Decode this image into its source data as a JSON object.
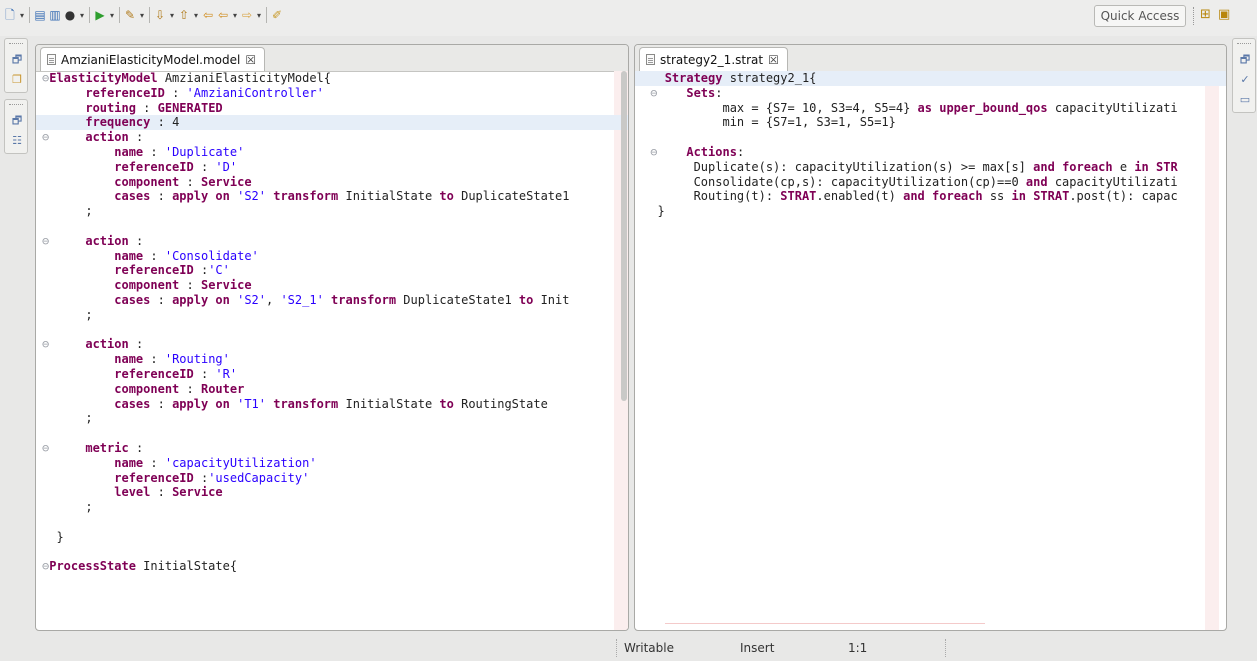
{
  "toolbar": {
    "icons": [
      "new-file-icon",
      "save-icon",
      "print-icon",
      "debug-icon",
      "run-icon",
      "external-tools-icon",
      "next-annotation-icon",
      "prev-annotation-icon",
      "back-icon",
      "forward-icon",
      "pin-icon"
    ],
    "quick_access": "Quick Access"
  },
  "editors": [
    {
      "tab": {
        "label": "AmzianiElasticityModel.model",
        "close": "☒"
      },
      "highlight_line": 3,
      "lines": [
        [
          {
            "t": "⊖",
            "c": "fold"
          },
          {
            "t": "ElasticityModel",
            "c": "kw"
          },
          {
            "t": " AmzianiElasticityModel{",
            "c": "plain"
          }
        ],
        [
          {
            "t": "      ",
            "c": "plain"
          },
          {
            "t": "referenceID",
            "c": "kw"
          },
          {
            "t": " : ",
            "c": "plain"
          },
          {
            "t": "'AmzianiController'",
            "c": "str"
          }
        ],
        [
          {
            "t": "      ",
            "c": "plain"
          },
          {
            "t": "routing",
            "c": "kw"
          },
          {
            "t": " : ",
            "c": "plain"
          },
          {
            "t": "GENERATED",
            "c": "kw"
          }
        ],
        [
          {
            "t": "      ",
            "c": "plain"
          },
          {
            "t": "frequency",
            "c": "kw"
          },
          {
            "t": " : 4",
            "c": "plain"
          }
        ],
        [
          {
            "t": "⊖",
            "c": "fold"
          },
          {
            "t": "     ",
            "c": "plain"
          },
          {
            "t": "action",
            "c": "kw"
          },
          {
            "t": " :",
            "c": "plain"
          }
        ],
        [
          {
            "t": "          ",
            "c": "plain"
          },
          {
            "t": "name",
            "c": "kw"
          },
          {
            "t": " : ",
            "c": "plain"
          },
          {
            "t": "'Duplicate'",
            "c": "str"
          }
        ],
        [
          {
            "t": "          ",
            "c": "plain"
          },
          {
            "t": "referenceID",
            "c": "kw"
          },
          {
            "t": " : ",
            "c": "plain"
          },
          {
            "t": "'D'",
            "c": "str"
          }
        ],
        [
          {
            "t": "          ",
            "c": "plain"
          },
          {
            "t": "component",
            "c": "kw"
          },
          {
            "t": " : ",
            "c": "plain"
          },
          {
            "t": "Service",
            "c": "kw"
          }
        ],
        [
          {
            "t": "          ",
            "c": "plain"
          },
          {
            "t": "cases",
            "c": "kw"
          },
          {
            "t": " : ",
            "c": "plain"
          },
          {
            "t": "apply on",
            "c": "kw"
          },
          {
            "t": " ",
            "c": "plain"
          },
          {
            "t": "'S2'",
            "c": "str"
          },
          {
            "t": " ",
            "c": "plain"
          },
          {
            "t": "transform",
            "c": "kw"
          },
          {
            "t": " InitialState ",
            "c": "plain"
          },
          {
            "t": "to",
            "c": "kw"
          },
          {
            "t": " DuplicateState1",
            "c": "plain"
          }
        ],
        [
          {
            "t": "      ;",
            "c": "plain"
          }
        ],
        [
          {
            "t": "",
            "c": "plain"
          }
        ],
        [
          {
            "t": "⊖",
            "c": "fold"
          },
          {
            "t": "     ",
            "c": "plain"
          },
          {
            "t": "action",
            "c": "kw"
          },
          {
            "t": " :",
            "c": "plain"
          }
        ],
        [
          {
            "t": "          ",
            "c": "plain"
          },
          {
            "t": "name",
            "c": "kw"
          },
          {
            "t": " : ",
            "c": "plain"
          },
          {
            "t": "'Consolidate'",
            "c": "str"
          }
        ],
        [
          {
            "t": "          ",
            "c": "plain"
          },
          {
            "t": "referenceID",
            "c": "kw"
          },
          {
            "t": " :",
            "c": "plain"
          },
          {
            "t": "'C'",
            "c": "str"
          }
        ],
        [
          {
            "t": "          ",
            "c": "plain"
          },
          {
            "t": "component",
            "c": "kw"
          },
          {
            "t": " : ",
            "c": "plain"
          },
          {
            "t": "Service",
            "c": "kw"
          }
        ],
        [
          {
            "t": "          ",
            "c": "plain"
          },
          {
            "t": "cases",
            "c": "kw"
          },
          {
            "t": " : ",
            "c": "plain"
          },
          {
            "t": "apply on",
            "c": "kw"
          },
          {
            "t": " ",
            "c": "plain"
          },
          {
            "t": "'S2'",
            "c": "str"
          },
          {
            "t": ", ",
            "c": "plain"
          },
          {
            "t": "'S2_1'",
            "c": "str"
          },
          {
            "t": " ",
            "c": "plain"
          },
          {
            "t": "transform",
            "c": "kw"
          },
          {
            "t": " DuplicateState1 ",
            "c": "plain"
          },
          {
            "t": "to",
            "c": "kw"
          },
          {
            "t": " Init",
            "c": "plain"
          }
        ],
        [
          {
            "t": "      ;",
            "c": "plain"
          }
        ],
        [
          {
            "t": "",
            "c": "plain"
          }
        ],
        [
          {
            "t": "⊖",
            "c": "fold"
          },
          {
            "t": "     ",
            "c": "plain"
          },
          {
            "t": "action",
            "c": "kw"
          },
          {
            "t": " :",
            "c": "plain"
          }
        ],
        [
          {
            "t": "          ",
            "c": "plain"
          },
          {
            "t": "name",
            "c": "kw"
          },
          {
            "t": " : ",
            "c": "plain"
          },
          {
            "t": "'Routing'",
            "c": "str"
          }
        ],
        [
          {
            "t": "          ",
            "c": "plain"
          },
          {
            "t": "referenceID",
            "c": "kw"
          },
          {
            "t": " : ",
            "c": "plain"
          },
          {
            "t": "'R'",
            "c": "str"
          }
        ],
        [
          {
            "t": "          ",
            "c": "plain"
          },
          {
            "t": "component",
            "c": "kw"
          },
          {
            "t": " : ",
            "c": "plain"
          },
          {
            "t": "Router",
            "c": "kw"
          }
        ],
        [
          {
            "t": "          ",
            "c": "plain"
          },
          {
            "t": "cases",
            "c": "kw"
          },
          {
            "t": " : ",
            "c": "plain"
          },
          {
            "t": "apply on",
            "c": "kw"
          },
          {
            "t": " ",
            "c": "plain"
          },
          {
            "t": "'T1'",
            "c": "str"
          },
          {
            "t": " ",
            "c": "plain"
          },
          {
            "t": "transform",
            "c": "kw"
          },
          {
            "t": " InitialState ",
            "c": "plain"
          },
          {
            "t": "to",
            "c": "kw"
          },
          {
            "t": " RoutingState",
            "c": "plain"
          }
        ],
        [
          {
            "t": "      ;",
            "c": "plain"
          }
        ],
        [
          {
            "t": "",
            "c": "plain"
          }
        ],
        [
          {
            "t": "⊖",
            "c": "fold"
          },
          {
            "t": "     ",
            "c": "plain"
          },
          {
            "t": "metric",
            "c": "kw"
          },
          {
            "t": " :",
            "c": "plain"
          }
        ],
        [
          {
            "t": "          ",
            "c": "plain"
          },
          {
            "t": "name",
            "c": "kw"
          },
          {
            "t": " : ",
            "c": "plain"
          },
          {
            "t": "'capacityUtilization'",
            "c": "str"
          }
        ],
        [
          {
            "t": "          ",
            "c": "plain"
          },
          {
            "t": "referenceID",
            "c": "kw"
          },
          {
            "t": " :",
            "c": "plain"
          },
          {
            "t": "'usedCapacity'",
            "c": "str"
          }
        ],
        [
          {
            "t": "          ",
            "c": "plain"
          },
          {
            "t": "level",
            "c": "kw"
          },
          {
            "t": " : ",
            "c": "plain"
          },
          {
            "t": "Service",
            "c": "kw"
          }
        ],
        [
          {
            "t": "      ;",
            "c": "plain"
          }
        ],
        [
          {
            "t": "",
            "c": "plain"
          }
        ],
        [
          {
            "t": "  }",
            "c": "plain"
          }
        ],
        [
          {
            "t": "",
            "c": "plain"
          }
        ],
        [
          {
            "t": "⊖",
            "c": "fold"
          },
          {
            "t": "ProcessState",
            "c": "kw"
          },
          {
            "t": " InitialState{",
            "c": "plain"
          }
        ]
      ]
    },
    {
      "tab": {
        "label": "strategy2_1.strat",
        "close": "☒"
      },
      "highlight_line": 0,
      "lines": [
        [
          {
            "t": "   ",
            "c": "plain"
          },
          {
            "t": "Strategy",
            "c": "kw"
          },
          {
            "t": " strategy2_1{",
            "c": "plain"
          }
        ],
        [
          {
            "t": " ⊖    ",
            "c": "fold"
          },
          {
            "t": "Sets",
            "c": "kw"
          },
          {
            "t": ":",
            "c": "plain"
          }
        ],
        [
          {
            "t": "           max = {S7= 10, S3=4, S5=4} ",
            "c": "plain"
          },
          {
            "t": "as",
            "c": "kw"
          },
          {
            "t": " ",
            "c": "plain"
          },
          {
            "t": "upper_bound_qos",
            "c": "kw"
          },
          {
            "t": " capacityUtilizati",
            "c": "plain"
          }
        ],
        [
          {
            "t": "           min = {S7=1, S3=1, S5=1}",
            "c": "plain"
          }
        ],
        [
          {
            "t": "",
            "c": "plain"
          }
        ],
        [
          {
            "t": " ⊖    ",
            "c": "fold"
          },
          {
            "t": "Actions",
            "c": "kw"
          },
          {
            "t": ":",
            "c": "plain"
          }
        ],
        [
          {
            "t": "       Duplicate(s): capacityUtilization(s) >= max[s] ",
            "c": "plain"
          },
          {
            "t": "and",
            "c": "kw"
          },
          {
            "t": " ",
            "c": "plain"
          },
          {
            "t": "foreach",
            "c": "kw"
          },
          {
            "t": " e ",
            "c": "plain"
          },
          {
            "t": "in",
            "c": "kw"
          },
          {
            "t": " ",
            "c": "plain"
          },
          {
            "t": "STR",
            "c": "kw"
          }
        ],
        [
          {
            "t": "       Consolidate(cp,s): capacityUtilization(cp)==0 ",
            "c": "plain"
          },
          {
            "t": "and",
            "c": "kw"
          },
          {
            "t": " capacityUtilizati",
            "c": "plain"
          }
        ],
        [
          {
            "t": "       Routing(t): ",
            "c": "plain"
          },
          {
            "t": "STRAT",
            "c": "kw"
          },
          {
            "t": ".enabled(t) ",
            "c": "plain"
          },
          {
            "t": "and",
            "c": "kw"
          },
          {
            "t": " ",
            "c": "plain"
          },
          {
            "t": "foreach",
            "c": "kw"
          },
          {
            "t": " ss ",
            "c": "plain"
          },
          {
            "t": "in",
            "c": "kw"
          },
          {
            "t": " ",
            "c": "plain"
          },
          {
            "t": "STRAT",
            "c": "kw"
          },
          {
            "t": ".post(t): capac",
            "c": "plain"
          }
        ],
        [
          {
            "t": "  }",
            "c": "plain"
          }
        ]
      ]
    }
  ],
  "status": {
    "writable": "Writable",
    "insert_mode": "Insert",
    "position": "1:1"
  }
}
